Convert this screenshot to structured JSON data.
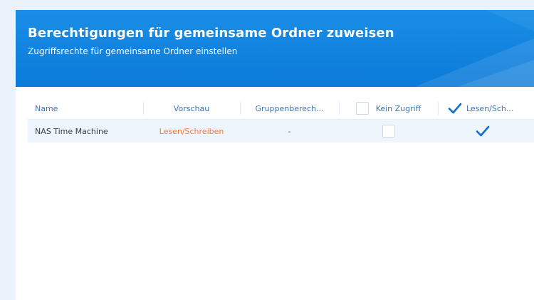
{
  "dialog": {
    "title": "Berechtigungen für gemeinsame Ordner zuweisen",
    "subtitle": "Zugriffsrechte für gemeinsame Ordner einstellen"
  },
  "grid": {
    "columns": {
      "name": "Name",
      "preview": "Vorschau",
      "group": "Gruppenberech...",
      "no_access": "Kein Zugriff",
      "read_write": "Lesen/Sch..."
    },
    "header_checkboxes": {
      "no_access_checked": false,
      "read_write_checked": true
    },
    "rows": [
      {
        "name": "NAS Time Machine",
        "preview": "Lesen/Schreiben",
        "group": "-",
        "no_access_checked": false,
        "read_write_checked": true
      }
    ]
  },
  "colors": {
    "header_bg": "#0b7ad9",
    "header_text": "#ffffff",
    "column_header_text": "#3e74b5",
    "preview_text": "#f07a3a",
    "check": "#0b6fd1",
    "selected_row_bg": "#eef5fc"
  },
  "icons": {
    "checked": "check-icon",
    "unchecked": "empty-checkbox"
  }
}
